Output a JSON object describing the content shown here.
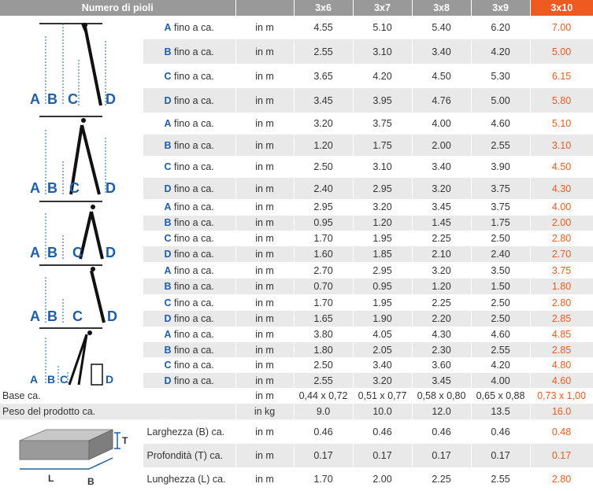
{
  "header": {
    "title": "Numero di pioli",
    "columns": [
      "3x6",
      "3x7",
      "3x8",
      "3x9",
      "3x10"
    ]
  },
  "colors": {
    "accent": "#ee5a1f",
    "letter": "#1d5ea8",
    "header": "#999999",
    "stripe": "#e9e9e9"
  },
  "diagram_letters": [
    "A",
    "B",
    "C",
    "D"
  ],
  "groups": [
    {
      "icon": "ladder-leaning-icon",
      "rows": [
        {
          "letter": "A",
          "label": "fino a ca.",
          "unit": "in m",
          "values": [
            "4.55",
            "5.10",
            "5.40",
            "6.20",
            "7.00"
          ]
        },
        {
          "letter": "B",
          "label": "fino a ca.",
          "unit": "in m",
          "values": [
            "2.55",
            "3.10",
            "3.40",
            "4.20",
            "5.00"
          ]
        },
        {
          "letter": "C",
          "label": "fino a ca.",
          "unit": "in m",
          "values": [
            "3.65",
            "4.20",
            "4.50",
            "5.30",
            "6.15"
          ]
        },
        {
          "letter": "D",
          "label": "fino a ca.",
          "unit": "in m",
          "values": [
            "3.45",
            "3.95",
            "4.76",
            "5.00",
            "5.80"
          ]
        }
      ]
    },
    {
      "icon": "ladder-a-frame-extended-icon",
      "rows": [
        {
          "letter": "A",
          "label": "fino a ca.",
          "unit": "in m",
          "values": [
            "3.20",
            "3.75",
            "4.00",
            "4.60",
            "5.10"
          ]
        },
        {
          "letter": "B",
          "label": "fino a ca.",
          "unit": "in m",
          "values": [
            "1.20",
            "1.75",
            "2.00",
            "2.55",
            "3.10"
          ]
        },
        {
          "letter": "C",
          "label": "fino a ca.",
          "unit": "in m",
          "values": [
            "2.50",
            "3.10",
            "3.40",
            "3.90",
            "4.50"
          ]
        },
        {
          "letter": "D",
          "label": "fino a ca.",
          "unit": "in m",
          "values": [
            "2.40",
            "2.95",
            "3.20",
            "3.75",
            "4.30"
          ]
        }
      ]
    },
    {
      "icon": "ladder-a-frame-icon",
      "rows": [
        {
          "letter": "A",
          "label": "fino a ca.",
          "unit": "in m",
          "values": [
            "2.95",
            "3.20",
            "3.45",
            "3.75",
            "4.00"
          ]
        },
        {
          "letter": "B",
          "label": "fino a ca.",
          "unit": "in m",
          "values": [
            "0.95",
            "1.20",
            "1.45",
            "1.75",
            "2.00"
          ]
        },
        {
          "letter": "C",
          "label": "fino a ca.",
          "unit": "in m",
          "values": [
            "1.70",
            "1.95",
            "2.25",
            "2.50",
            "2.80"
          ]
        },
        {
          "letter": "D",
          "label": "fino a ca.",
          "unit": "in m",
          "values": [
            "1.60",
            "1.85",
            "2.10",
            "2.40",
            "2.70"
          ]
        }
      ]
    },
    {
      "icon": "ladder-single-leaning-icon",
      "rows": [
        {
          "letter": "A",
          "label": "fino a ca.",
          "unit": "in m",
          "values": [
            "2.70",
            "2.95",
            "3.20",
            "3.50",
            "3.75"
          ]
        },
        {
          "letter": "B",
          "label": "fino a ca.",
          "unit": "in m",
          "values": [
            "0.70",
            "0.95",
            "1.20",
            "1.50",
            "1.80"
          ]
        },
        {
          "letter": "C",
          "label": "fino a ca.",
          "unit": "in m",
          "values": [
            "1.70",
            "1.95",
            "2.25",
            "2.50",
            "2.80"
          ]
        },
        {
          "letter": "D",
          "label": "fino a ca.",
          "unit": "in m",
          "values": [
            "1.65",
            "1.90",
            "2.20",
            "2.50",
            "2.85"
          ]
        }
      ]
    },
    {
      "icon": "ladder-stair-icon",
      "rows": [
        {
          "letter": "A",
          "label": "fino a ca.",
          "unit": "in m",
          "values": [
            "3.80",
            "4.05",
            "4.30",
            "4.60",
            "4.85"
          ]
        },
        {
          "letter": "B",
          "label": "fino a ca.",
          "unit": "in m",
          "values": [
            "1.80",
            "2.05",
            "2.30",
            "2.55",
            "2.85"
          ]
        },
        {
          "letter": "C",
          "label": "fino a ca.",
          "unit": "in m",
          "values": [
            "2.50",
            "3.40",
            "3.60",
            "4.20",
            "4.80"
          ]
        },
        {
          "letter": "D",
          "label": "fino a ca.",
          "unit": "in m",
          "values": [
            "2.55",
            "3.20",
            "3.45",
            "4.00",
            "4.60"
          ]
        }
      ]
    }
  ],
  "base": {
    "label": "Base ca.",
    "unit": "in m",
    "values": [
      "0,44 x 0,72",
      "0,51 x 0,77",
      "0,58 x 0,80",
      "0,65 x 0,88",
      "0,73 x 1,00"
    ]
  },
  "weight": {
    "label": "Peso del prodotto ca.",
    "unit": "in kg",
    "values": [
      "9.0",
      "10.0",
      "12.0",
      "13.5",
      "16.0"
    ]
  },
  "package": {
    "icon": "package-box-icon",
    "letters": {
      "t": "T",
      "l": "L",
      "b": "B"
    },
    "rows": [
      {
        "label": "Larghezza (B) ca.",
        "unit": "in m",
        "values": [
          "0.46",
          "0.46",
          "0.46",
          "0.46",
          "0.48"
        ]
      },
      {
        "label": "Profondità (T) ca.",
        "unit": "in m",
        "values": [
          "0.17",
          "0.17",
          "0.17",
          "0.17",
          "0.17"
        ]
      },
      {
        "label": "Lunghezza (L) ca.",
        "unit": "in m",
        "values": [
          "1.70",
          "2.00",
          "2.25",
          "2.55",
          "2.80"
        ]
      }
    ]
  }
}
